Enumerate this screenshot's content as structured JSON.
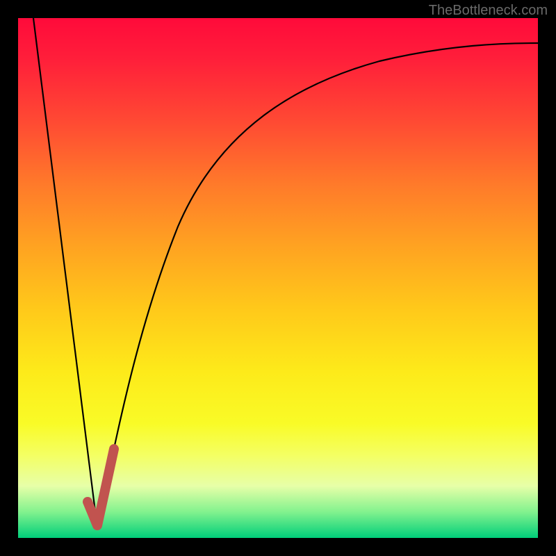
{
  "watermark": "TheBottleneck.com",
  "chart_data": {
    "type": "line",
    "title": "",
    "xlabel": "",
    "ylabel": "",
    "xlim": [
      0,
      100
    ],
    "ylim": [
      0,
      100
    ],
    "series": [
      {
        "name": "left-descending-line",
        "x": [
          3,
          15
        ],
        "y": [
          100,
          2
        ]
      },
      {
        "name": "right-rising-curve",
        "x": [
          15,
          18,
          24,
          32,
          42,
          54,
          68,
          84,
          100
        ],
        "y": [
          2,
          18,
          42,
          62,
          76,
          84,
          89,
          92,
          94
        ]
      },
      {
        "name": "optimal-zone-highlight",
        "x": [
          13,
          15,
          18
        ],
        "y": [
          6,
          2,
          17
        ],
        "color": "#c1534f"
      }
    ],
    "background_gradient": {
      "top": "#ff0a3a",
      "bottom": "#00ce7a"
    }
  }
}
